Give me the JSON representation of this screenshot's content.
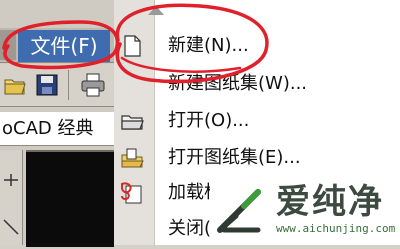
{
  "menubar": {
    "file_label": "文件(F)"
  },
  "workspace": {
    "label": "oCAD 经典"
  },
  "file_menu": {
    "items": [
      {
        "label": "新建(N)...",
        "icon": "new-file-icon"
      },
      {
        "label": "新建图纸集(W)...",
        "icon": ""
      },
      {
        "label": "打开(O)...",
        "icon": "open-folder-icon"
      },
      {
        "label": "打开图纸集(E)...",
        "icon": "open-sheet-set-icon"
      },
      {
        "label": "加载标记集(K)...",
        "icon": "load-markup-icon"
      },
      {
        "label": "关闭(C)",
        "icon": ""
      }
    ]
  },
  "watermark": {
    "brand": "爱纯净",
    "url": "www.aichunjing.com"
  },
  "colors": {
    "menu_highlight": "#3f6cae",
    "annotation_red": "#e0202a"
  }
}
